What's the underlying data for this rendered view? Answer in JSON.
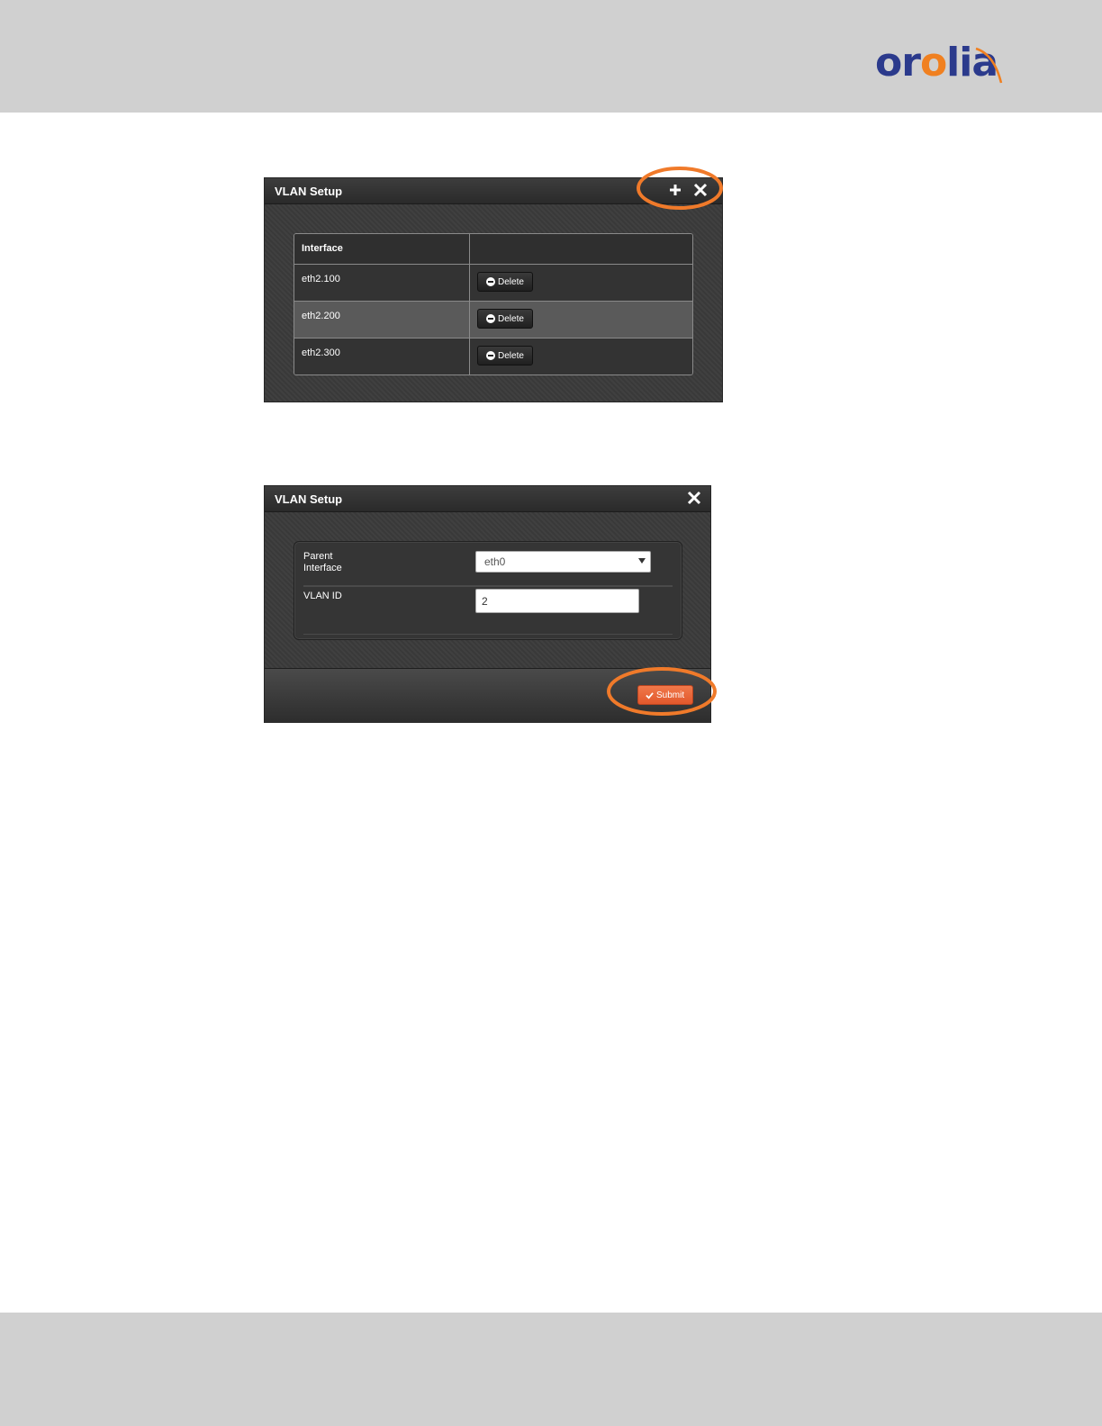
{
  "brand": {
    "logo_text_main": "or",
    "logo_text_accent": "o",
    "logo_text_end": "lia"
  },
  "colors": {
    "accent": "#f08020",
    "brand_blue": "#2b3a8c",
    "submit": "#e8623a",
    "annotation": "#f07a2a"
  },
  "dialog_list": {
    "title": "VLAN Setup",
    "icons": [
      "plus-icon",
      "close-icon"
    ],
    "table": {
      "header": "Interface",
      "rows": [
        {
          "interface": "eth2.100",
          "action": "Delete"
        },
        {
          "interface": "eth2.200",
          "action": "Delete"
        },
        {
          "interface": "eth2.300",
          "action": "Delete"
        }
      ]
    }
  },
  "dialog_form": {
    "title": "VLAN Setup",
    "icons": [
      "close-icon"
    ],
    "parent_interface_label": "Parent\nInterface",
    "parent_interface_value": "eth0",
    "vlan_id_label": "VLAN ID",
    "vlan_id_value": "2",
    "submit_label": "Submit"
  }
}
